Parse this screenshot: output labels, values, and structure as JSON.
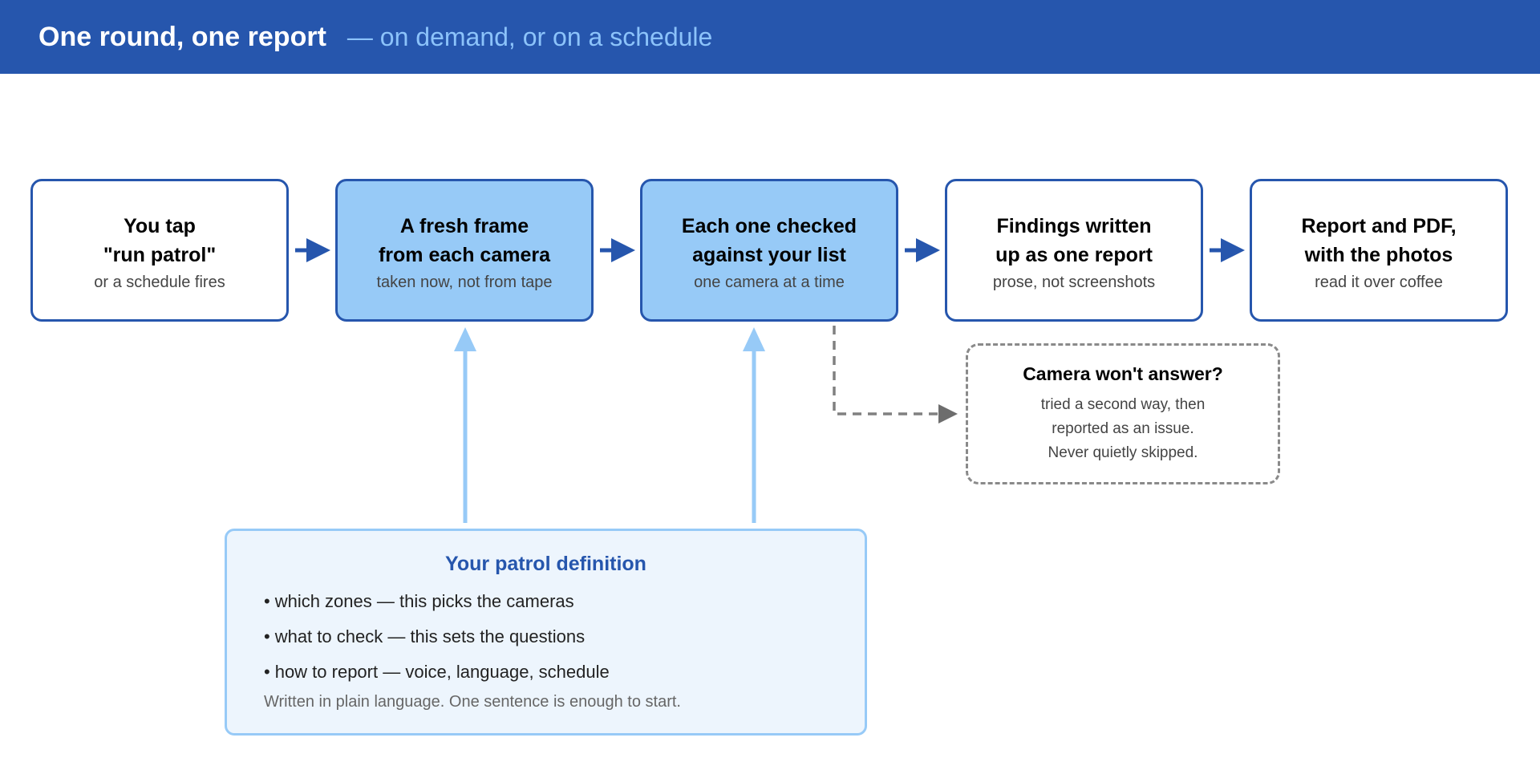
{
  "header": {
    "title": "One round, one report",
    "subtitle": "— on demand, or on a schedule"
  },
  "steps": [
    {
      "line1": "You tap",
      "line2": "\"run patrol\"",
      "sub": "or a schedule fires"
    },
    {
      "line1": "A fresh frame",
      "line2": "from each camera",
      "sub": "taken now, not from tape"
    },
    {
      "line1": "Each one checked",
      "line2": "against your list",
      "sub": "one camera at a time"
    },
    {
      "line1": "Findings written",
      "line2": "up as one report",
      "sub": "prose, not screenshots"
    },
    {
      "line1": "Report and PDF,",
      "line2": "with the photos",
      "sub": "read it over coffee"
    }
  ],
  "fallback": {
    "title": "Camera won't answer?",
    "lines": [
      "tried a second way, then",
      "reported as an issue.",
      "Never quietly skipped."
    ]
  },
  "definition": {
    "title": "Your patrol definition",
    "bullet_char": "•",
    "items": [
      "which zones — this picks the cameras",
      "what to check — this sets the questions",
      "how to report — voice, language, schedule"
    ],
    "note": "Written in plain language. One sentence is enough to start."
  },
  "colors": {
    "header_bg": "#2656ad",
    "accent_light": "#8cc3fa",
    "step_border": "#2656ad",
    "step_highlight": "#97caf7",
    "feed_arrow": "#97caf7",
    "fallback_dash": "#808080",
    "definition_bg": "#edf5fd"
  }
}
